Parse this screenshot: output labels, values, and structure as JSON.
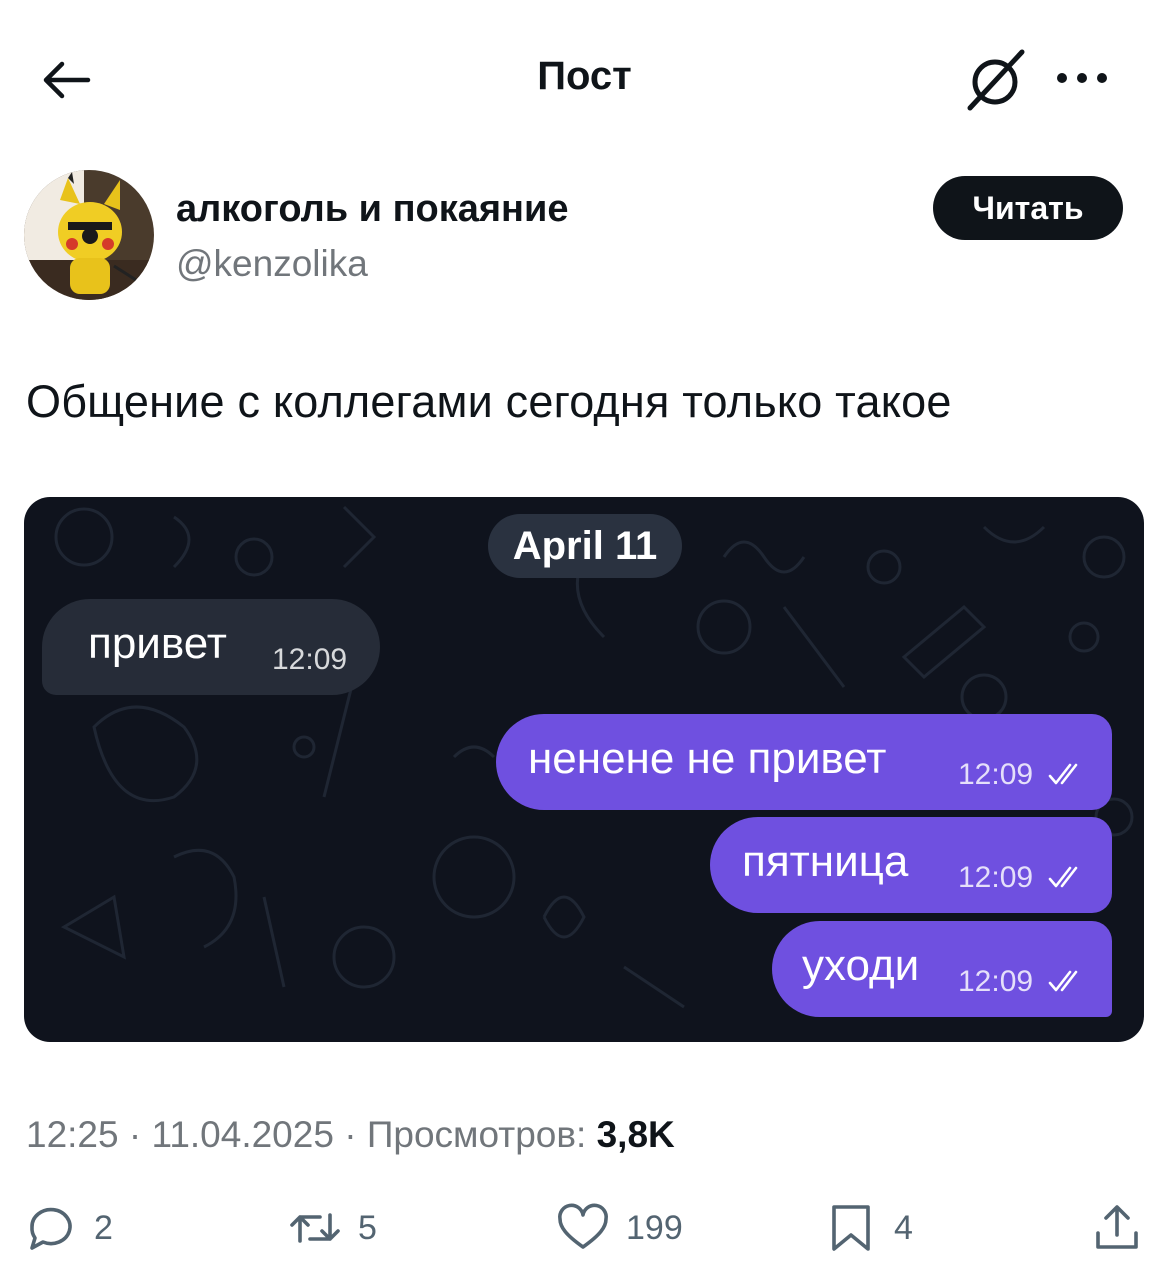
{
  "header": {
    "title": "Пост"
  },
  "author": {
    "name": "алкоголь и покаяние",
    "handle": "@kenzolika",
    "follow_label": "Читать"
  },
  "post": {
    "text": "Общение с коллегами сегодня только такое"
  },
  "chat": {
    "date": "April 11",
    "messages": [
      {
        "text": "привет",
        "time": "12:09",
        "direction": "incoming"
      },
      {
        "text": "ненене не привет",
        "time": "12:09",
        "direction": "outgoing",
        "read": true
      },
      {
        "text": "пятница",
        "time": "12:09",
        "direction": "outgoing",
        "read": true
      },
      {
        "text": "уходи",
        "time": "12:09",
        "direction": "outgoing",
        "read": true
      }
    ],
    "colors": {
      "background": "#0f131d",
      "incoming": "#262c38",
      "outgoing": "#6f50e0"
    }
  },
  "meta": {
    "time": "12:25",
    "date": "11.04.2025",
    "views_label": "Просмотров:",
    "views": "3,8K"
  },
  "actions": {
    "replies": "2",
    "reposts": "5",
    "likes": "199",
    "bookmarks": "4",
    "icons": [
      "reply-icon",
      "repost-icon",
      "heart-icon",
      "bookmark-icon",
      "share-icon"
    ]
  }
}
